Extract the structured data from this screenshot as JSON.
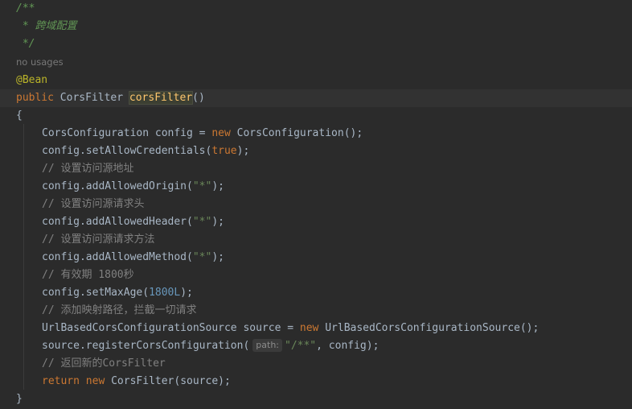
{
  "code": {
    "doc_open": "/**",
    "doc_text": " * 跨域配置",
    "doc_close": " */",
    "usages": "no usages",
    "annotation": "@Bean",
    "sig_kw": "public",
    "sig_type": " CorsFilter ",
    "sig_method": "corsFilter",
    "sig_parens": "()",
    "open_brace": "{",
    "l1_a": "CorsConfiguration config = ",
    "l1_kw": "new",
    "l1_b": " CorsConfiguration();",
    "l2_a": "config.setAllowCredentials(",
    "l2_kw": "true",
    "l2_b": ");",
    "c1": "// 设置访问源地址",
    "l3_a": "config.addAllowedOrigin(",
    "l3_str": "\"*\"",
    "l3_b": ");",
    "c2": "// 设置访问源请求头",
    "l4_a": "config.addAllowedHeader(",
    "l4_str": "\"*\"",
    "l4_b": ");",
    "c3": "// 设置访问源请求方法",
    "l5_a": "config.addAllowedMethod(",
    "l5_str": "\"*\"",
    "l5_b": ");",
    "c4": "// 有效期 1800秒",
    "l6_a": "config.setMaxAge(",
    "l6_num": "1800L",
    "l6_b": ");",
    "c5": "// 添加映射路径，拦截一切请求",
    "l7_a": "UrlBasedCorsConfigurationSource source = ",
    "l7_kw": "new",
    "l7_b": " UrlBasedCorsConfigurationSource();",
    "l8_a": "source.registerCorsConfiguration(",
    "l8_hint": "path:",
    "l8_str": "\"/**\"",
    "l8_b": ", config);",
    "c6": "// 返回新的CorsFilter",
    "l9_kw1": "return",
    "l9_kw2": "new",
    "l9_b": " CorsFilter(source);",
    "close_brace": "}"
  },
  "colors": {
    "background": "#2b2b2b",
    "current_line": "#323232",
    "keyword": "#cc7832",
    "string": "#6a8759",
    "number": "#6897bb",
    "comment": "#808080",
    "doc_comment": "#629755",
    "annotation": "#bbb529",
    "method_declaration": "#ffc66d",
    "default_text": "#a9b7c6"
  }
}
